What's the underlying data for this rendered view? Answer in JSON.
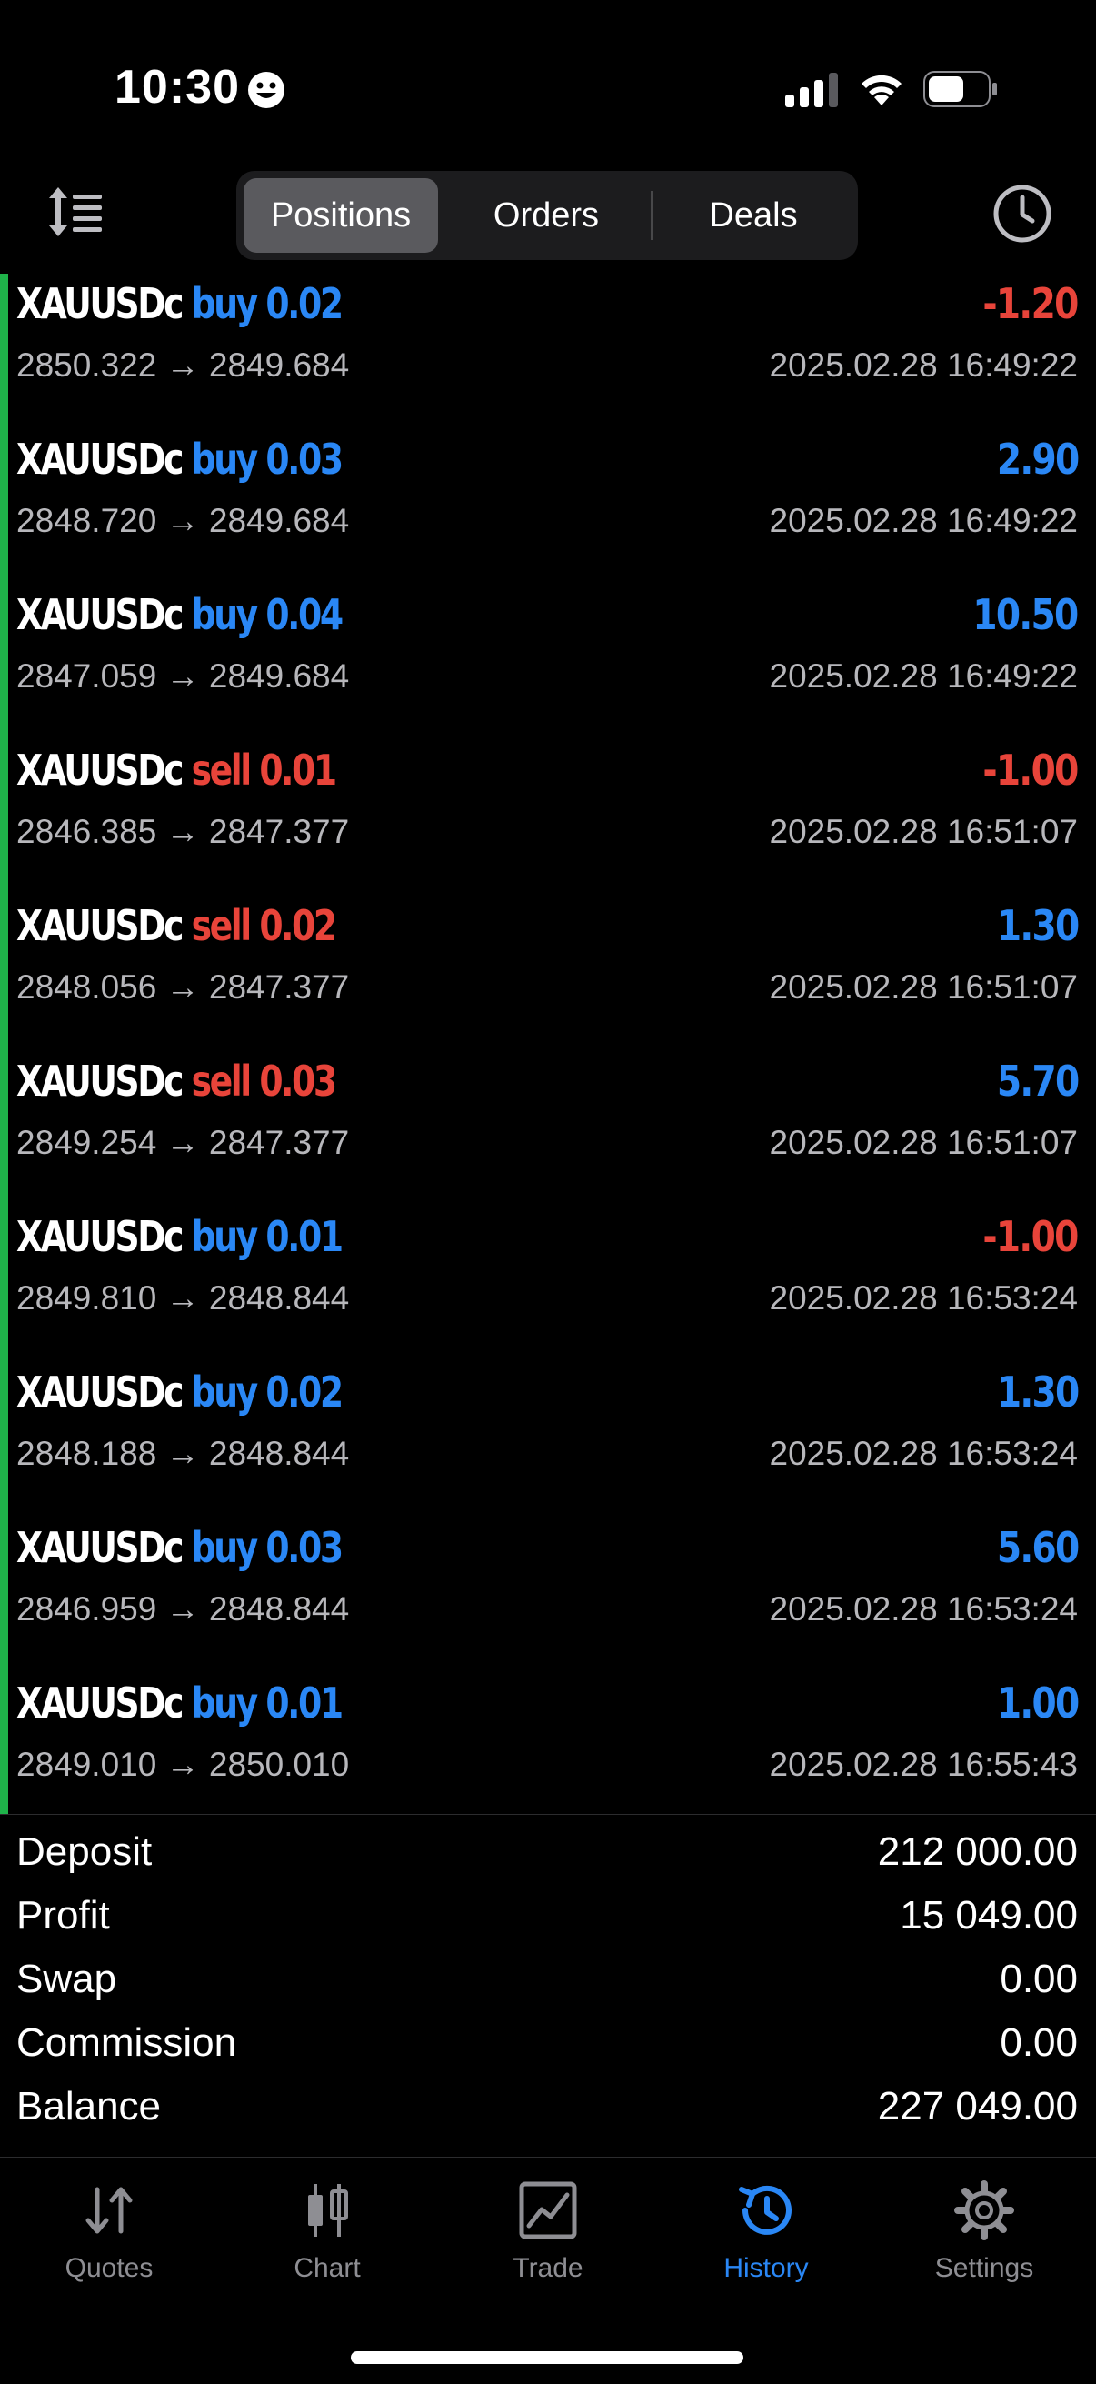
{
  "status_bar": {
    "time": "10:30"
  },
  "tabs_segment": [
    {
      "label": "Positions",
      "active": true
    },
    {
      "label": "Orders",
      "active": false
    },
    {
      "label": "Deals",
      "active": false
    }
  ],
  "deals": [
    {
      "symbol": "XAUUSDc",
      "side": "buy 0.02",
      "prices": "2850.322 → 2849.684",
      "profit": "-1.20",
      "time": "2025.02.28 16:49:22"
    },
    {
      "symbol": "XAUUSDc",
      "side": "buy 0.03",
      "prices": "2848.720 → 2849.684",
      "profit": "2.90",
      "time": "2025.02.28 16:49:22"
    },
    {
      "symbol": "XAUUSDc",
      "side": "buy 0.04",
      "prices": "2847.059 → 2849.684",
      "profit": "10.50",
      "time": "2025.02.28 16:49:22"
    },
    {
      "symbol": "XAUUSDc",
      "side": "sell 0.01",
      "prices": "2846.385 → 2847.377",
      "profit": "-1.00",
      "time": "2025.02.28 16:51:07"
    },
    {
      "symbol": "XAUUSDc",
      "side": "sell 0.02",
      "prices": "2848.056 → 2847.377",
      "profit": "1.30",
      "time": "2025.02.28 16:51:07"
    },
    {
      "symbol": "XAUUSDc",
      "side": "sell 0.03",
      "prices": "2849.254 → 2847.377",
      "profit": "5.70",
      "time": "2025.02.28 16:51:07"
    },
    {
      "symbol": "XAUUSDc",
      "side": "buy 0.01",
      "prices": "2849.810 → 2848.844",
      "profit": "-1.00",
      "time": "2025.02.28 16:53:24"
    },
    {
      "symbol": "XAUUSDc",
      "side": "buy 0.02",
      "prices": "2848.188 → 2848.844",
      "profit": "1.30",
      "time": "2025.02.28 16:53:24"
    },
    {
      "symbol": "XAUUSDc",
      "side": "buy 0.03",
      "prices": "2846.959 → 2848.844",
      "profit": "5.60",
      "time": "2025.02.28 16:53:24"
    },
    {
      "symbol": "XAUUSDc",
      "side": "buy 0.01",
      "prices": "2849.010 → 2850.010",
      "profit": "1.00",
      "time": "2025.02.28 16:55:43"
    }
  ],
  "summary": [
    {
      "label": "Deposit",
      "value": "212 000.00"
    },
    {
      "label": "Profit",
      "value": "15 049.00"
    },
    {
      "label": "Swap",
      "value": "0.00"
    },
    {
      "label": "Commission",
      "value": "0.00"
    },
    {
      "label": "Balance",
      "value": "227 049.00"
    }
  ],
  "tab_bar": [
    {
      "label": "Quotes",
      "icon": "quotes-icon",
      "active": false
    },
    {
      "label": "Chart",
      "icon": "chart-icon",
      "active": false
    },
    {
      "label": "Trade",
      "icon": "trade-icon",
      "active": false
    },
    {
      "label": "History",
      "icon": "history-icon",
      "active": true
    },
    {
      "label": "Settings",
      "icon": "gear-icon",
      "active": false
    }
  ],
  "colors": {
    "buy": "#2a87f5",
    "sell": "#e8443a",
    "profit_positive": "#2a87f5",
    "profit_negative": "#e8443a",
    "accent_bar": "#1fb34a"
  }
}
